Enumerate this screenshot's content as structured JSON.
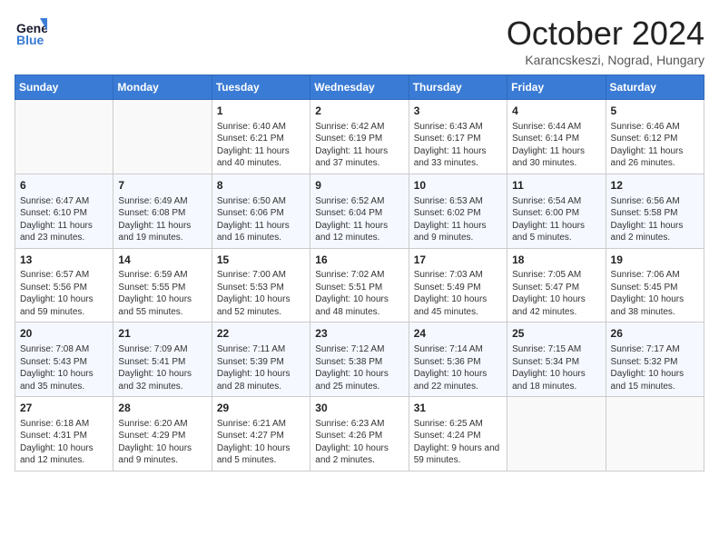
{
  "header": {
    "logo_line1": "General",
    "logo_line2": "Blue",
    "month_title": "October 2024",
    "subtitle": "Karancskeszi, Nograd, Hungary"
  },
  "days_of_week": [
    "Sunday",
    "Monday",
    "Tuesday",
    "Wednesday",
    "Thursday",
    "Friday",
    "Saturday"
  ],
  "weeks": [
    [
      {
        "day": "",
        "info": ""
      },
      {
        "day": "",
        "info": ""
      },
      {
        "day": "1",
        "info": "Sunrise: 6:40 AM\nSunset: 6:21 PM\nDaylight: 11 hours and 40 minutes."
      },
      {
        "day": "2",
        "info": "Sunrise: 6:42 AM\nSunset: 6:19 PM\nDaylight: 11 hours and 37 minutes."
      },
      {
        "day": "3",
        "info": "Sunrise: 6:43 AM\nSunset: 6:17 PM\nDaylight: 11 hours and 33 minutes."
      },
      {
        "day": "4",
        "info": "Sunrise: 6:44 AM\nSunset: 6:14 PM\nDaylight: 11 hours and 30 minutes."
      },
      {
        "day": "5",
        "info": "Sunrise: 6:46 AM\nSunset: 6:12 PM\nDaylight: 11 hours and 26 minutes."
      }
    ],
    [
      {
        "day": "6",
        "info": "Sunrise: 6:47 AM\nSunset: 6:10 PM\nDaylight: 11 hours and 23 minutes."
      },
      {
        "day": "7",
        "info": "Sunrise: 6:49 AM\nSunset: 6:08 PM\nDaylight: 11 hours and 19 minutes."
      },
      {
        "day": "8",
        "info": "Sunrise: 6:50 AM\nSunset: 6:06 PM\nDaylight: 11 hours and 16 minutes."
      },
      {
        "day": "9",
        "info": "Sunrise: 6:52 AM\nSunset: 6:04 PM\nDaylight: 11 hours and 12 minutes."
      },
      {
        "day": "10",
        "info": "Sunrise: 6:53 AM\nSunset: 6:02 PM\nDaylight: 11 hours and 9 minutes."
      },
      {
        "day": "11",
        "info": "Sunrise: 6:54 AM\nSunset: 6:00 PM\nDaylight: 11 hours and 5 minutes."
      },
      {
        "day": "12",
        "info": "Sunrise: 6:56 AM\nSunset: 5:58 PM\nDaylight: 11 hours and 2 minutes."
      }
    ],
    [
      {
        "day": "13",
        "info": "Sunrise: 6:57 AM\nSunset: 5:56 PM\nDaylight: 10 hours and 59 minutes."
      },
      {
        "day": "14",
        "info": "Sunrise: 6:59 AM\nSunset: 5:55 PM\nDaylight: 10 hours and 55 minutes."
      },
      {
        "day": "15",
        "info": "Sunrise: 7:00 AM\nSunset: 5:53 PM\nDaylight: 10 hours and 52 minutes."
      },
      {
        "day": "16",
        "info": "Sunrise: 7:02 AM\nSunset: 5:51 PM\nDaylight: 10 hours and 48 minutes."
      },
      {
        "day": "17",
        "info": "Sunrise: 7:03 AM\nSunset: 5:49 PM\nDaylight: 10 hours and 45 minutes."
      },
      {
        "day": "18",
        "info": "Sunrise: 7:05 AM\nSunset: 5:47 PM\nDaylight: 10 hours and 42 minutes."
      },
      {
        "day": "19",
        "info": "Sunrise: 7:06 AM\nSunset: 5:45 PM\nDaylight: 10 hours and 38 minutes."
      }
    ],
    [
      {
        "day": "20",
        "info": "Sunrise: 7:08 AM\nSunset: 5:43 PM\nDaylight: 10 hours and 35 minutes."
      },
      {
        "day": "21",
        "info": "Sunrise: 7:09 AM\nSunset: 5:41 PM\nDaylight: 10 hours and 32 minutes."
      },
      {
        "day": "22",
        "info": "Sunrise: 7:11 AM\nSunset: 5:39 PM\nDaylight: 10 hours and 28 minutes."
      },
      {
        "day": "23",
        "info": "Sunrise: 7:12 AM\nSunset: 5:38 PM\nDaylight: 10 hours and 25 minutes."
      },
      {
        "day": "24",
        "info": "Sunrise: 7:14 AM\nSunset: 5:36 PM\nDaylight: 10 hours and 22 minutes."
      },
      {
        "day": "25",
        "info": "Sunrise: 7:15 AM\nSunset: 5:34 PM\nDaylight: 10 hours and 18 minutes."
      },
      {
        "day": "26",
        "info": "Sunrise: 7:17 AM\nSunset: 5:32 PM\nDaylight: 10 hours and 15 minutes."
      }
    ],
    [
      {
        "day": "27",
        "info": "Sunrise: 6:18 AM\nSunset: 4:31 PM\nDaylight: 10 hours and 12 minutes."
      },
      {
        "day": "28",
        "info": "Sunrise: 6:20 AM\nSunset: 4:29 PM\nDaylight: 10 hours and 9 minutes."
      },
      {
        "day": "29",
        "info": "Sunrise: 6:21 AM\nSunset: 4:27 PM\nDaylight: 10 hours and 5 minutes."
      },
      {
        "day": "30",
        "info": "Sunrise: 6:23 AM\nSunset: 4:26 PM\nDaylight: 10 hours and 2 minutes."
      },
      {
        "day": "31",
        "info": "Sunrise: 6:25 AM\nSunset: 4:24 PM\nDaylight: 9 hours and 59 minutes."
      },
      {
        "day": "",
        "info": ""
      },
      {
        "day": "",
        "info": ""
      }
    ]
  ]
}
